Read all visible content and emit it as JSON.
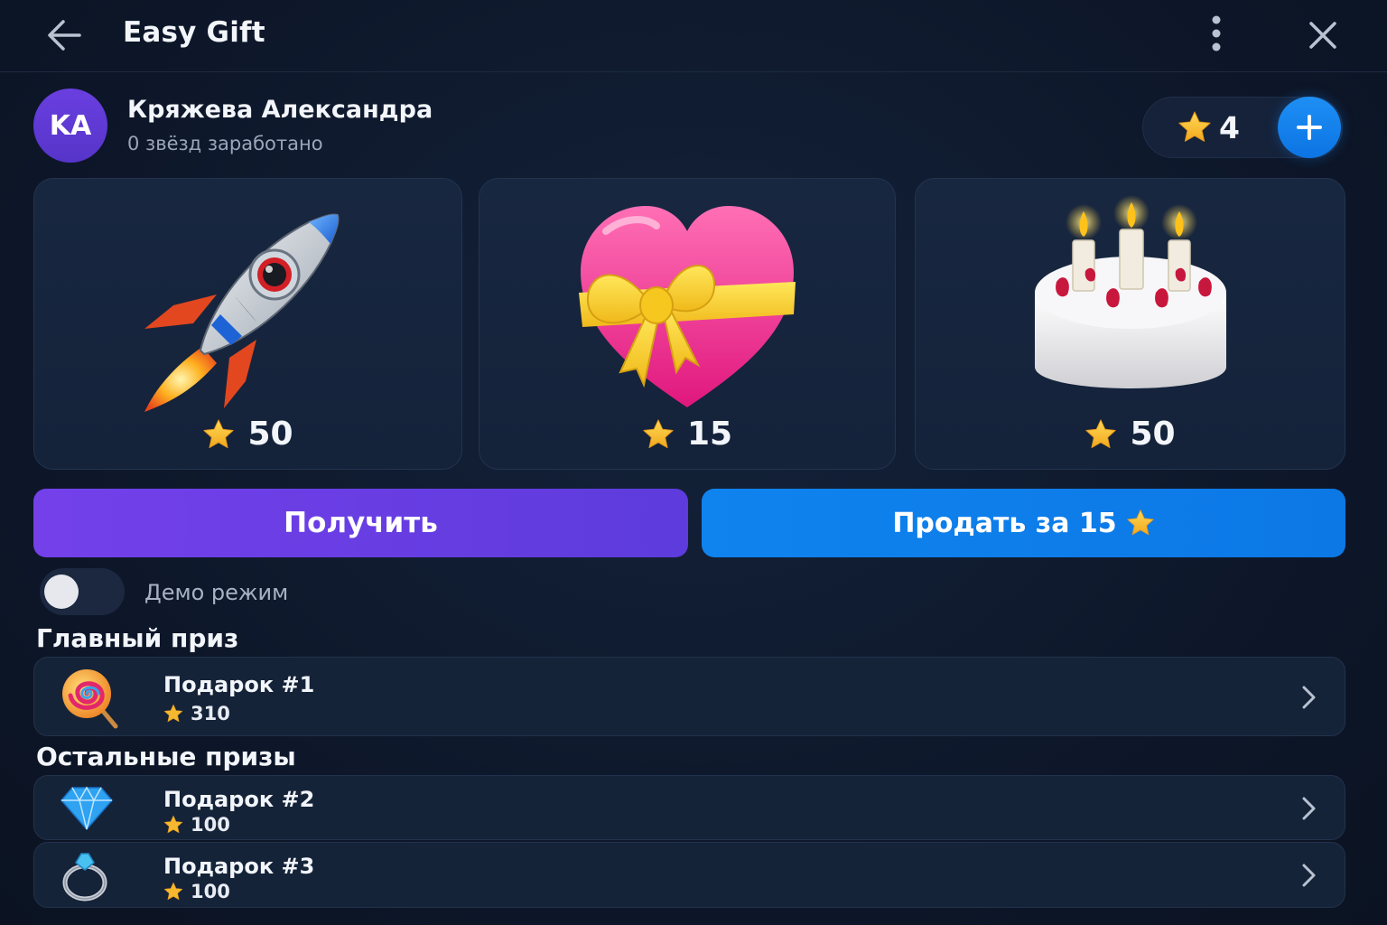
{
  "header": {
    "title": "Easy Gift",
    "back_icon": "arrow-left-icon",
    "menu_icon": "more-vertical-icon",
    "close_icon": "close-icon"
  },
  "profile": {
    "initials": "KA",
    "name": "Кряжева Александра",
    "stars_earned": "0 звёзд заработано",
    "balance": "4",
    "add_icon": "plus-icon"
  },
  "gifts": [
    {
      "icon": "rocket-icon",
      "price": "50"
    },
    {
      "icon": "heart-gift-icon",
      "price": "15"
    },
    {
      "icon": "birthday-cake-icon",
      "price": "50"
    }
  ],
  "actions": {
    "get_label": "Получить",
    "sell_label": "Продать за 15"
  },
  "demo": {
    "label": "Демо режим",
    "enabled": false
  },
  "main_prize": {
    "title": "Главный приз",
    "items": [
      {
        "name": "Подарок #1",
        "price": "310",
        "icon": "lollipop-icon"
      }
    ]
  },
  "other_prizes": {
    "title": "Остальные призы",
    "items": [
      {
        "name": "Подарок #2",
        "price": "100",
        "icon": "diamond-icon"
      },
      {
        "name": "Подарок #3",
        "price": "100",
        "icon": "ring-icon"
      }
    ]
  },
  "colors": {
    "background": "#0f1a2e",
    "primary_purple": "#6a3fe6",
    "primary_blue": "#0d7deb",
    "star": "#f5b82e"
  }
}
